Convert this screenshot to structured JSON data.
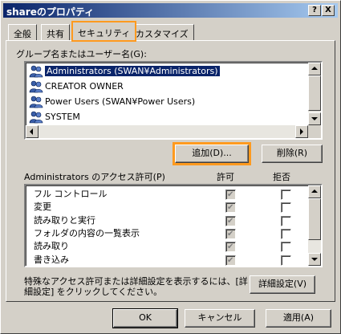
{
  "window": {
    "title": "shareのプロパティ",
    "help_button": "?",
    "close_button": "X"
  },
  "tabs": [
    {
      "label": "全般"
    },
    {
      "label": "共有"
    },
    {
      "label": "セキュリティ"
    },
    {
      "label": "カスタマイズ"
    }
  ],
  "users": {
    "label": "グループ名またはユーザー名(G):",
    "items": [
      {
        "label": "Administrators (SWAN¥Administrators)",
        "selected": true
      },
      {
        "label": "CREATOR OWNER",
        "selected": false
      },
      {
        "label": "Power Users (SWAN¥Power Users)",
        "selected": false
      },
      {
        "label": "SYSTEM",
        "selected": false
      }
    ]
  },
  "buttons": {
    "add": "追加(D)...",
    "remove": "削除(R)",
    "advanced": "詳細設定(V)",
    "ok": "OK",
    "cancel": "キャンセル",
    "apply": "適用(A)"
  },
  "permissions": {
    "label": "Administrators のアクセス許可(P)",
    "allow_header": "許可",
    "deny_header": "拒否",
    "rows": [
      {
        "name": "フル コントロール",
        "allow": true,
        "deny": false
      },
      {
        "name": "変更",
        "allow": true,
        "deny": false
      },
      {
        "name": "読み取りと実行",
        "allow": true,
        "deny": false
      },
      {
        "name": "フォルダの内容の一覧表示",
        "allow": true,
        "deny": false
      },
      {
        "name": "読み取り",
        "allow": true,
        "deny": false
      },
      {
        "name": "書き込み",
        "allow": true,
        "deny": false
      }
    ]
  },
  "advanced_note_line1": "特殊なアクセス許可または詳細設定を表示するには、[詳",
  "advanced_note_line2": "細設定] をクリックしてください。",
  "colors": {
    "highlight": "#ff9a1f",
    "selection": "#0a246a",
    "face": "#d4d0c8"
  }
}
